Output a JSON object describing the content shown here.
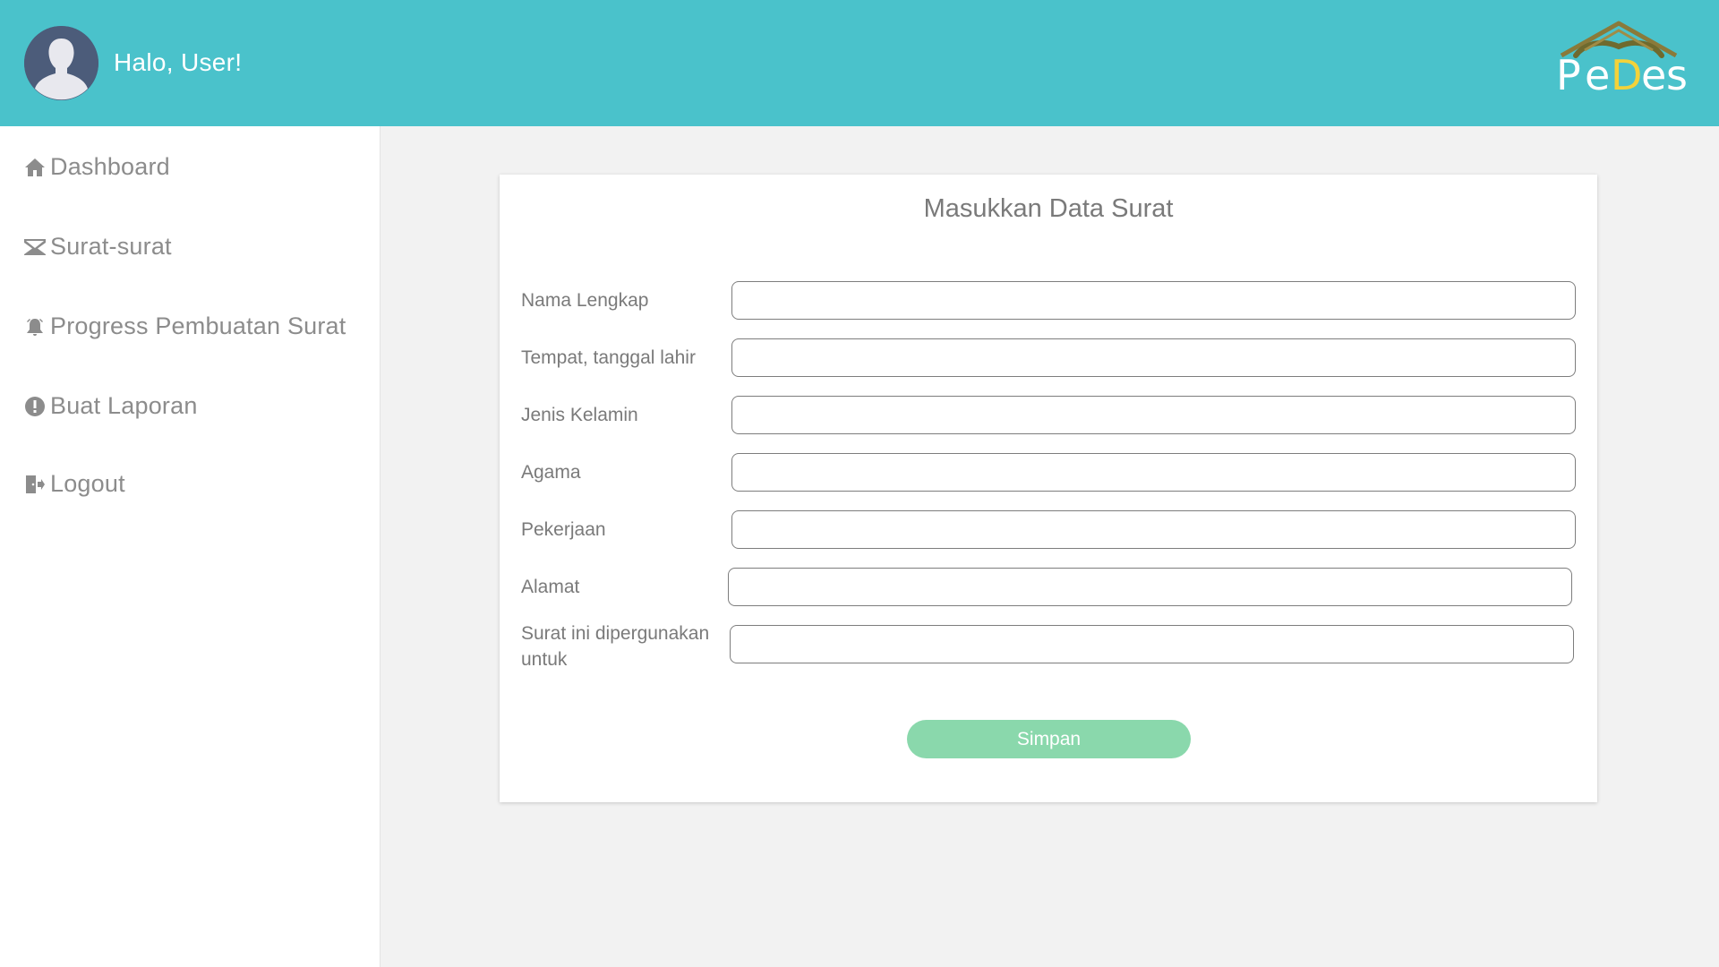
{
  "header": {
    "greeting": "Halo, User!",
    "logo_text": "PeDes",
    "background_color": "#4ac2cb"
  },
  "sidebar": {
    "items": [
      {
        "label": "Dashboard",
        "icon": "home-icon"
      },
      {
        "label": "Surat-surat",
        "icon": "envelope-icon"
      },
      {
        "label": "Progress Pembuatan Surat",
        "icon": "alarm-bell-icon"
      },
      {
        "label": "Buat Laporan",
        "icon": "exclamation-circle-icon"
      },
      {
        "label": "Logout",
        "icon": "sign-out-icon"
      }
    ]
  },
  "form": {
    "title": "Masukkan Data Surat",
    "fields": [
      {
        "label": "Nama Lengkap",
        "value": ""
      },
      {
        "label": "Tempat, tanggal lahir",
        "value": ""
      },
      {
        "label": "Jenis Kelamin",
        "value": ""
      },
      {
        "label": "Agama",
        "value": ""
      },
      {
        "label": "Pekerjaan",
        "value": ""
      },
      {
        "label": "Alamat",
        "value": ""
      },
      {
        "label": "Surat ini dipergunakan untuk",
        "value": ""
      }
    ],
    "submit_label": "Simpan",
    "submit_color": "#8ad8ac"
  }
}
